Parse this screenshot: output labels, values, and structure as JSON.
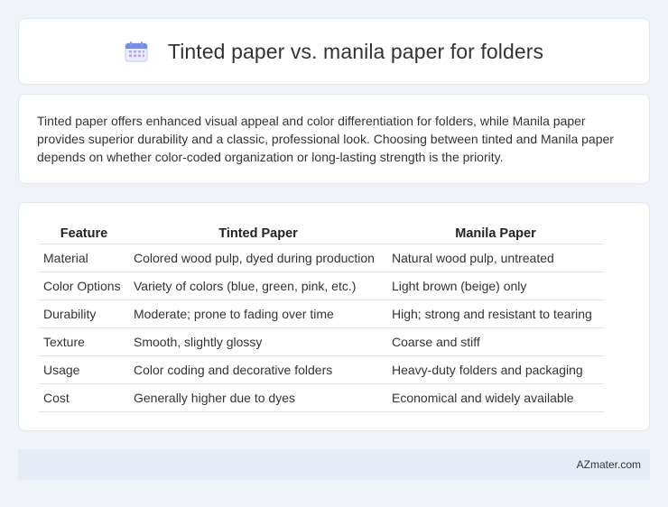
{
  "header": {
    "title": "Tinted paper vs. manila paper for folders",
    "icon": "calendar-icon"
  },
  "summary": {
    "text": "Tinted paper offers enhanced visual appeal and color differentiation for folders, while Manila paper provides superior durability and a classic, professional look. Choosing between tinted and Manila paper depends on whether color-coded organization or long-lasting strength is the priority."
  },
  "table": {
    "headers": [
      "Feature",
      "Tinted Paper",
      "Manila Paper"
    ],
    "rows": [
      [
        "Material",
        "Colored wood pulp, dyed during production",
        "Natural wood pulp, untreated"
      ],
      [
        "Color Options",
        "Variety of colors (blue, green, pink, etc.)",
        "Light brown (beige) only"
      ],
      [
        "Durability",
        "Moderate; prone to fading over time",
        "High; strong and resistant to tearing"
      ],
      [
        "Texture",
        "Smooth, slightly glossy",
        "Coarse and stiff"
      ],
      [
        "Usage",
        "Color coding and decorative folders",
        "Heavy-duty folders and packaging"
      ],
      [
        "Cost",
        "Generally higher due to dyes",
        "Economical and widely available"
      ]
    ]
  },
  "footer": {
    "site": "AZmater.com"
  },
  "colors": {
    "background": "#f0f3f8",
    "card": "#ffffff",
    "footer": "#e6ecf5",
    "icon_accent": "#5b7de8"
  }
}
